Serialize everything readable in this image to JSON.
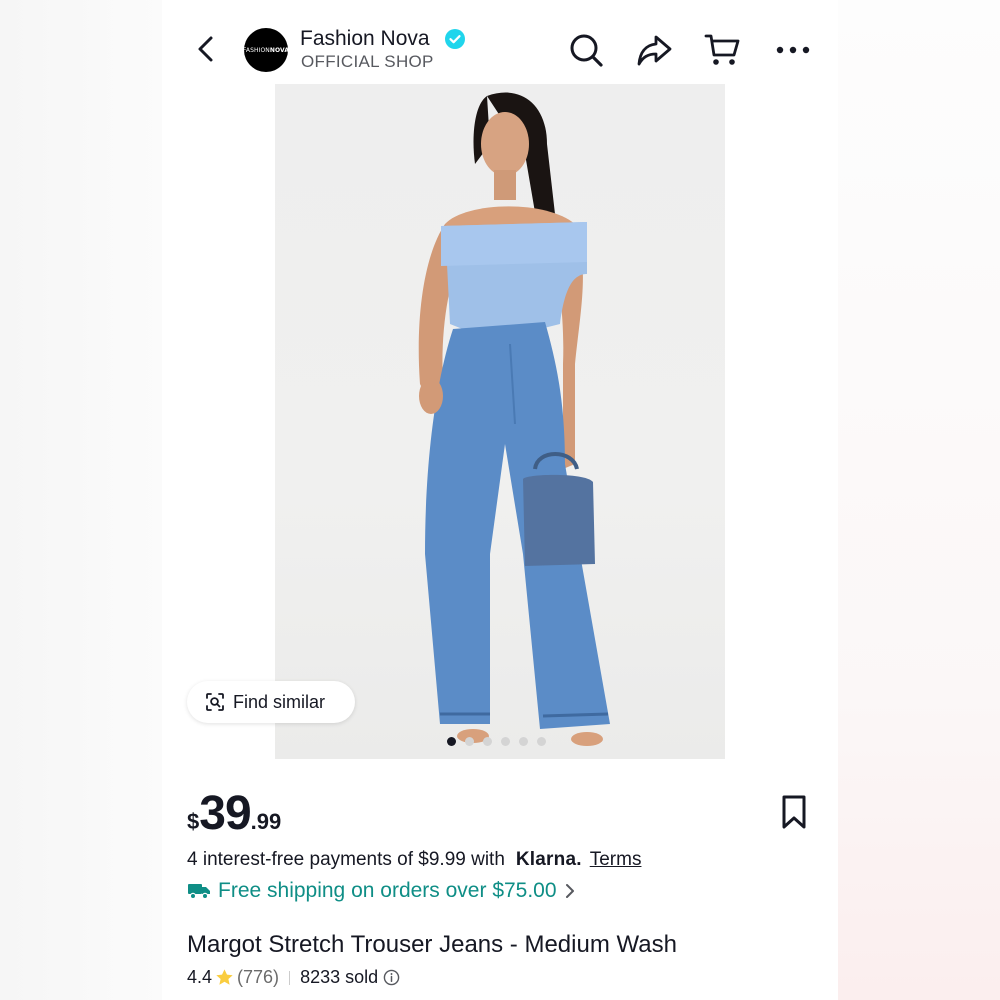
{
  "header": {
    "shop_name": "Fashion Nova",
    "shop_subtitle": "OFFICIAL SHOP",
    "logo_text_light": "FASHION",
    "logo_text_bold": "NOVA"
  },
  "gallery": {
    "find_similar_label": "Find similar",
    "image_count": 6,
    "active_index": 0
  },
  "product": {
    "price_currency": "$",
    "price_whole": "39",
    "price_cents": ".99",
    "installments_text": "4 interest-free payments of $9.99 with",
    "klarna_label": "Klarna.",
    "terms_label": "Terms",
    "shipping_text": "Free shipping on orders over $75.00",
    "title": "Margot Stretch Trouser Jeans - Medium Wash",
    "rating": "4.4",
    "review_count": "(776)",
    "sold_text": "8233 sold"
  },
  "colors": {
    "accent_teal": "#0f8e86",
    "verified_blue": "#20d5ec",
    "star_yellow": "#facd3f",
    "text_dark": "#161823"
  },
  "icons": [
    "back-icon",
    "verified-icon",
    "search-icon",
    "share-icon",
    "cart-icon",
    "more-icon",
    "scan-icon",
    "bookmark-icon",
    "truck-icon",
    "chevron-right-icon",
    "star-icon",
    "info-icon"
  ]
}
